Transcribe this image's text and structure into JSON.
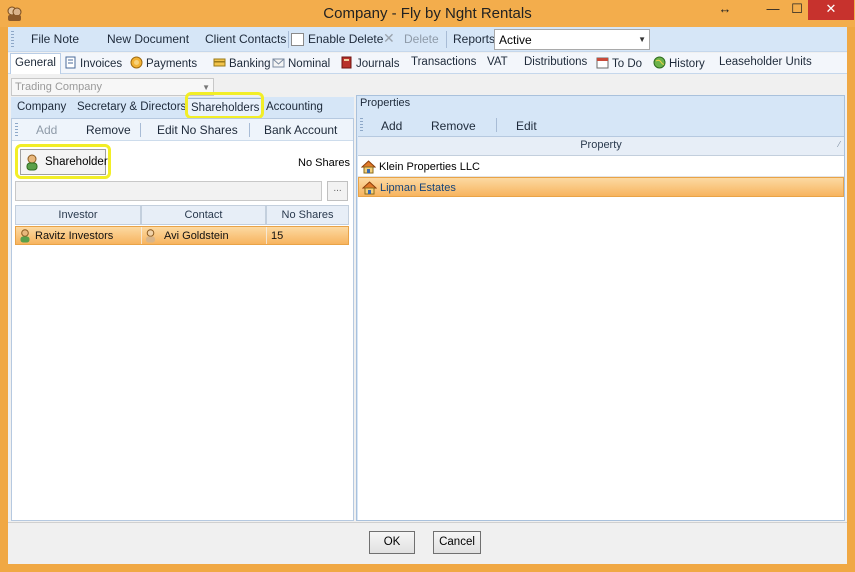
{
  "window": {
    "title": "Company - Fly by Nght Rentals"
  },
  "toolbar": {
    "file_note": "File Note",
    "new_document": "New Document",
    "client_contacts": "Client Contacts",
    "enable_delete": "Enable Delete",
    "delete": "Delete",
    "reports": "Reports",
    "status_value": "Active"
  },
  "nav_tabs": [
    "General",
    "Invoices",
    "Payments",
    "Banking",
    "Nominal",
    "Journals",
    "Transactions",
    "VAT",
    "Distributions",
    "To Do",
    "History",
    "Leaseholder Units"
  ],
  "left": {
    "company_type": "Trading Company",
    "subtabs": [
      "Company",
      "Secretary & Directors",
      "Shareholders",
      "Accounting"
    ],
    "actions": {
      "add": "Add",
      "remove": "Remove",
      "edit_no_shares": "Edit No Shares",
      "bank_account": "Bank Account"
    },
    "shareholder_button": "Shareholder",
    "no_shares_label": "No Shares",
    "browse": "...",
    "columns": [
      "Investor",
      "Contact",
      "No Shares"
    ],
    "rows": [
      {
        "investor": "Ravitz Investors",
        "contact": "Avi Goldstein",
        "shares": "15"
      }
    ]
  },
  "right": {
    "title": "Properties",
    "actions": {
      "add": "Add",
      "remove": "Remove",
      "edit": "Edit"
    },
    "column": "Property",
    "rows": [
      "Klein Properties LLC",
      "Lipman Estates"
    ]
  },
  "footer": {
    "ok": "OK",
    "cancel": "Cancel"
  },
  "colors": {
    "frame": "#f0a844",
    "selection": "#f7b45f",
    "highlight": "#f2ee27",
    "toolbar": "#d6e6f7"
  }
}
